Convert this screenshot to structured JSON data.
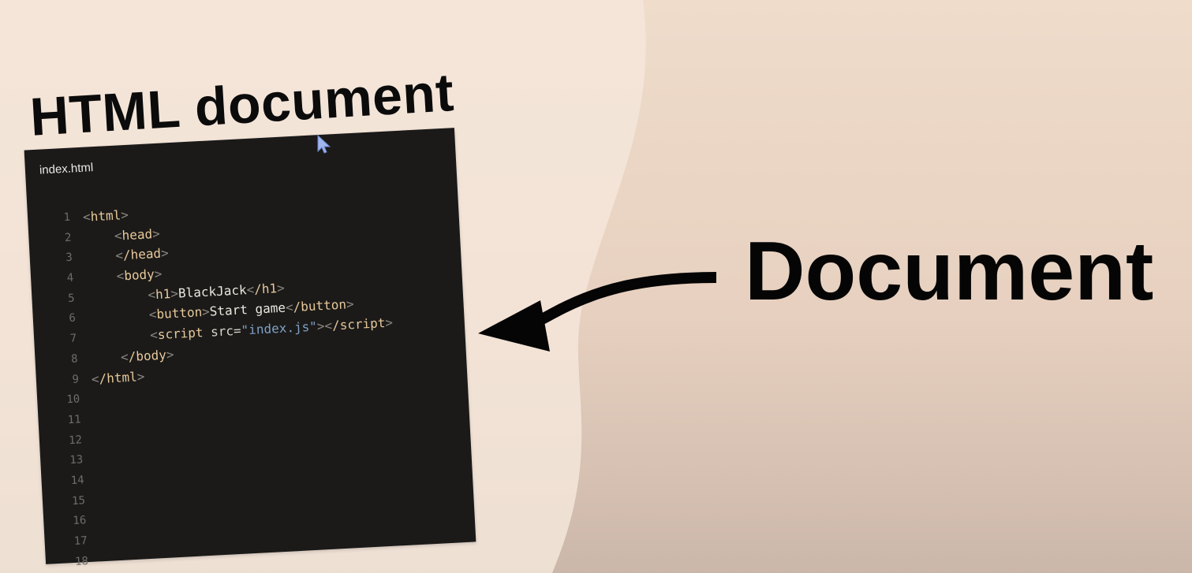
{
  "heading": "HTML document",
  "label": "Document",
  "editor": {
    "filename": "index.html",
    "line_numbers": [
      "1",
      "2",
      "3",
      "4",
      "5",
      "6",
      "7",
      "8",
      "9",
      "10",
      "11",
      "12",
      "13",
      "14",
      "15",
      "16",
      "17",
      "18"
    ],
    "code": {
      "l1_tag": "html",
      "l2_tag": "head",
      "l3_tag": "/head",
      "l4_tag": "body",
      "l5_tag": "h1",
      "l5_text": "BlackJack",
      "l5_close": "/h1",
      "l6_tag": "button",
      "l6_text": "Start game",
      "l6_close": "/button",
      "l7_tag": "script",
      "l7_attr": "src=",
      "l7_value": "\"index.js\"",
      "l7_close": "/script",
      "l8_tag": "/body",
      "l9_tag": "/html"
    }
  },
  "colors": {
    "background": "#efdccb",
    "editor_bg": "#1b1a19",
    "tag": "#e8c99a",
    "string": "#7fa1c4",
    "cursor": "#9fb6ef"
  },
  "icons": {
    "pointer": "mouse-cursor-icon",
    "arrow": "curved-arrow-icon"
  }
}
